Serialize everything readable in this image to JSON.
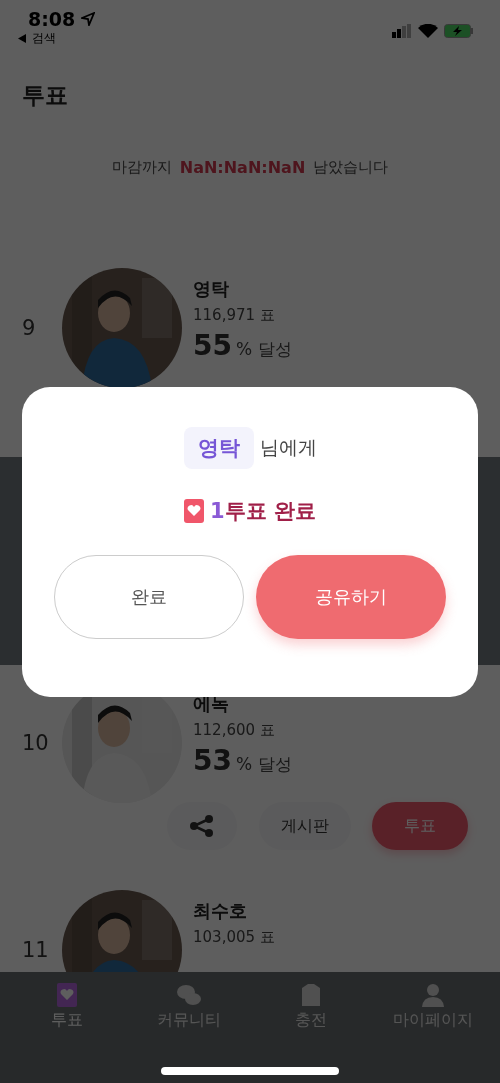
{
  "status_bar": {
    "time": "8:08",
    "back_label": "검색"
  },
  "header": {
    "title": "투표"
  },
  "deadline": {
    "prefix": "마감까지",
    "countdown": "NaN:NaN:NaN",
    "suffix": "남았습니다"
  },
  "items": [
    {
      "kind": "candidate",
      "rank": "9",
      "name": "영탁",
      "votes": "116,971 표",
      "percent": "55",
      "percent_suffix": "% 달성"
    },
    {
      "kind": "banner"
    },
    {
      "kind": "candidate",
      "rank": "10",
      "name": "에녹",
      "votes": "112,600 표",
      "percent": "53",
      "percent_suffix": "% 달성",
      "actions": {
        "board": "게시판",
        "vote": "투표"
      }
    },
    {
      "kind": "candidate",
      "rank": "11",
      "name": "최수호",
      "votes": "103,005 표"
    }
  ],
  "tabs": [
    {
      "label": "투표",
      "selected": true
    },
    {
      "label": "커뮤니티",
      "selected": false
    },
    {
      "label": "충전",
      "selected": false
    },
    {
      "label": "마이페이지",
      "selected": false
    }
  ],
  "modal": {
    "recipient": "영탁",
    "recipient_suffix": "님에게",
    "count": "1",
    "result": "투표 완료",
    "buttons": [
      {
        "label": "완료",
        "kind": "outline"
      },
      {
        "label": "공유하기",
        "kind": "primary"
      }
    ]
  }
}
